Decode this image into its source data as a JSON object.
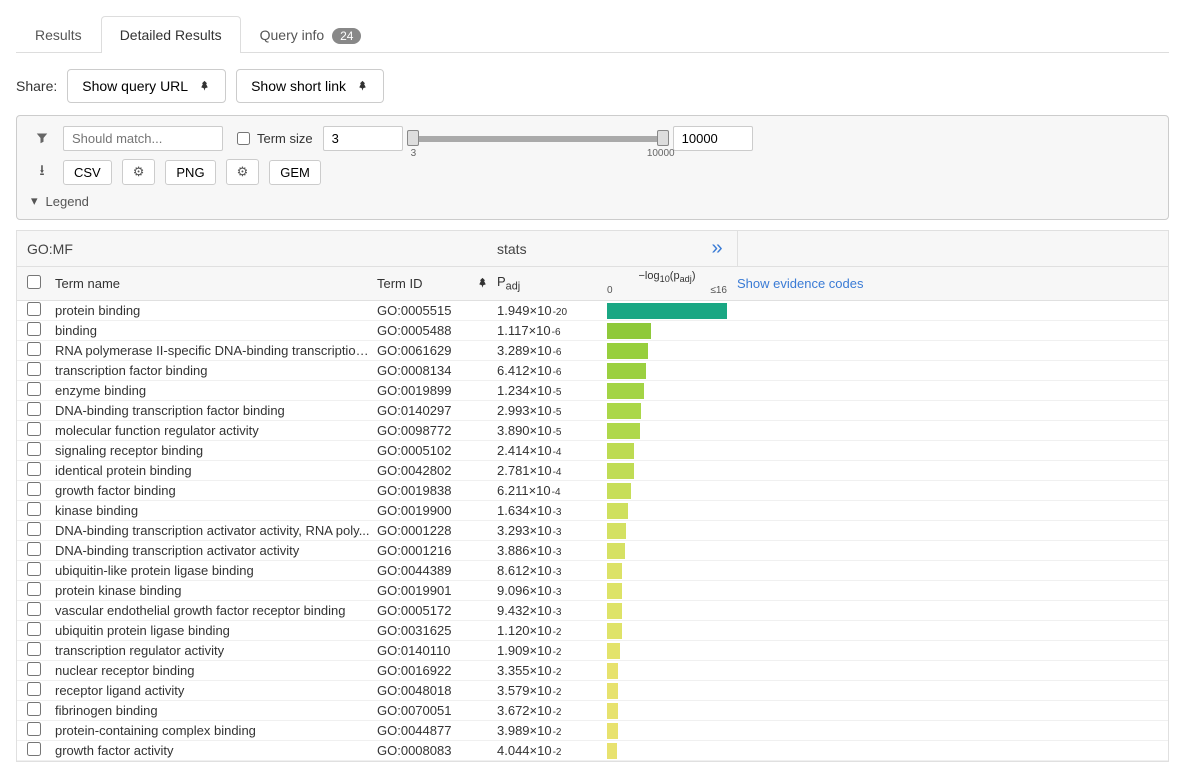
{
  "tabs": {
    "results": "Results",
    "detailed": "Detailed Results",
    "query": "Query info",
    "query_badge": "24"
  },
  "share": {
    "label": "Share:",
    "showQueryURL": "Show query URL",
    "showShortLink": "Show short link"
  },
  "filters": {
    "matchPlaceholder": "Should match...",
    "termSizeLabel": "Term size",
    "termSizeMin": "3",
    "termSizeMax": "10000",
    "sliderMinLabel": "3",
    "sliderMaxLabel": "10000",
    "csv": "CSV",
    "png": "PNG",
    "gem": "GEM",
    "legend": "Legend"
  },
  "tableHeader": {
    "go": "GO:MF",
    "stats": "stats",
    "termName": "Term name",
    "termID": "Term ID",
    "padj": "P",
    "padjSub": "adj",
    "logLabel": "−log",
    "logSub": "10",
    "logP": "(p",
    "logPSub": "adj",
    "logClose": ")",
    "axis0": "0",
    "axis16": "≤16",
    "evidence": "Show evidence codes"
  },
  "chart_data": {
    "type": "bar",
    "xlabel": "−log10(padj)",
    "xlim": [
      0,
      16
    ],
    "categories": [
      "protein binding",
      "binding",
      "RNA polymerase II-specific DNA-binding transcription ...",
      "transcription factor binding",
      "enzyme binding",
      "DNA-binding transcription factor binding",
      "molecular function regulator activity",
      "signaling receptor binding",
      "identical protein binding",
      "growth factor binding",
      "kinase binding",
      "DNA-binding transcription activator activity, RNA poly...",
      "DNA-binding transcription activator activity",
      "ubiquitin-like protein ligase binding",
      "protein kinase binding",
      "vascular endothelial growth factor receptor binding",
      "ubiquitin protein ligase binding",
      "transcription regulator activity",
      "nuclear receptor binding",
      "receptor ligand activity",
      "fibrinogen binding",
      "protein-containing complex binding",
      "growth factor activity"
    ],
    "series": [
      {
        "name": "-log10(padj)",
        "values": [
          19.71,
          5.95,
          5.48,
          5.19,
          4.91,
          4.52,
          4.41,
          3.62,
          3.56,
          3.21,
          2.79,
          2.48,
          2.41,
          2.06,
          2.04,
          2.03,
          1.95,
          1.72,
          1.47,
          1.45,
          1.44,
          1.4,
          1.39
        ]
      }
    ]
  },
  "rows": [
    {
      "name": "protein binding",
      "id": "GO:0005515",
      "mant": "1.949",
      "exp": "-20",
      "bar": 120,
      "color": "#1aa783"
    },
    {
      "name": "binding",
      "id": "GO:0005488",
      "mant": "1.117",
      "exp": "-6",
      "bar": 44,
      "color": "#8fc93a"
    },
    {
      "name": "RNA polymerase II-specific DNA-binding transcription ...",
      "id": "GO:0061629",
      "mant": "3.289",
      "exp": "-6",
      "bar": 41,
      "color": "#97cf3d"
    },
    {
      "name": "transcription factor binding",
      "id": "GO:0008134",
      "mant": "6.412",
      "exp": "-6",
      "bar": 39,
      "color": "#9bd040"
    },
    {
      "name": "enzyme binding",
      "id": "GO:0019899",
      "mant": "1.234",
      "exp": "-5",
      "bar": 37,
      "color": "#a3d445"
    },
    {
      "name": "DNA-binding transcription factor binding",
      "id": "GO:0140297",
      "mant": "2.993",
      "exp": "-5",
      "bar": 34,
      "color": "#abd749"
    },
    {
      "name": "molecular function regulator activity",
      "id": "GO:0098772",
      "mant": "3.890",
      "exp": "-5",
      "bar": 33,
      "color": "#afd84b"
    },
    {
      "name": "signaling receptor binding",
      "id": "GO:0005102",
      "mant": "2.414",
      "exp": "-4",
      "bar": 27,
      "color": "#bddb52"
    },
    {
      "name": "identical protein binding",
      "id": "GO:0042802",
      "mant": "2.781",
      "exp": "-4",
      "bar": 27,
      "color": "#c0dc55"
    },
    {
      "name": "growth factor binding",
      "id": "GO:0019838",
      "mant": "6.211",
      "exp": "-4",
      "bar": 24,
      "color": "#c7de59"
    },
    {
      "name": "kinase binding",
      "id": "GO:0019900",
      "mant": "1.634",
      "exp": "-3",
      "bar": 21,
      "color": "#cfe05e"
    },
    {
      "name": "DNA-binding transcription activator activity, RNA poly...",
      "id": "GO:0001228",
      "mant": "3.293",
      "exp": "-3",
      "bar": 19,
      "color": "#d4e162"
    },
    {
      "name": "DNA-binding transcription activator activity",
      "id": "GO:0001216",
      "mant": "3.886",
      "exp": "-3",
      "bar": 18,
      "color": "#d6e163"
    },
    {
      "name": "ubiquitin-like protein ligase binding",
      "id": "GO:0044389",
      "mant": "8.612",
      "exp": "-3",
      "bar": 15,
      "color": "#dce267"
    },
    {
      "name": "protein kinase binding",
      "id": "GO:0019901",
      "mant": "9.096",
      "exp": "-3",
      "bar": 15,
      "color": "#dde367"
    },
    {
      "name": "vascular endothelial growth factor receptor binding",
      "id": "GO:0005172",
      "mant": "9.432",
      "exp": "-3",
      "bar": 15,
      "color": "#dee368"
    },
    {
      "name": "ubiquitin protein ligase binding",
      "id": "GO:0031625",
      "mant": "1.120",
      "exp": "-2",
      "bar": 15,
      "color": "#dfe369"
    },
    {
      "name": "transcription regulator activity",
      "id": "GO:0140110",
      "mant": "1.909",
      "exp": "-2",
      "bar": 13,
      "color": "#e3e36b"
    },
    {
      "name": "nuclear receptor binding",
      "id": "GO:0016922",
      "mant": "3.355",
      "exp": "-2",
      "bar": 11,
      "color": "#e7e26d"
    },
    {
      "name": "receptor ligand activity",
      "id": "GO:0048018",
      "mant": "3.579",
      "exp": "-2",
      "bar": 11,
      "color": "#e7e26e"
    },
    {
      "name": "fibrinogen binding",
      "id": "GO:0070051",
      "mant": "3.672",
      "exp": "-2",
      "bar": 11,
      "color": "#e7e26e"
    },
    {
      "name": "protein-containing complex binding",
      "id": "GO:0044877",
      "mant": "3.989",
      "exp": "-2",
      "bar": 11,
      "color": "#e8e26e"
    },
    {
      "name": "growth factor activity",
      "id": "GO:0008083",
      "mant": "4.044",
      "exp": "-2",
      "bar": 10,
      "color": "#e8e26f"
    }
  ]
}
